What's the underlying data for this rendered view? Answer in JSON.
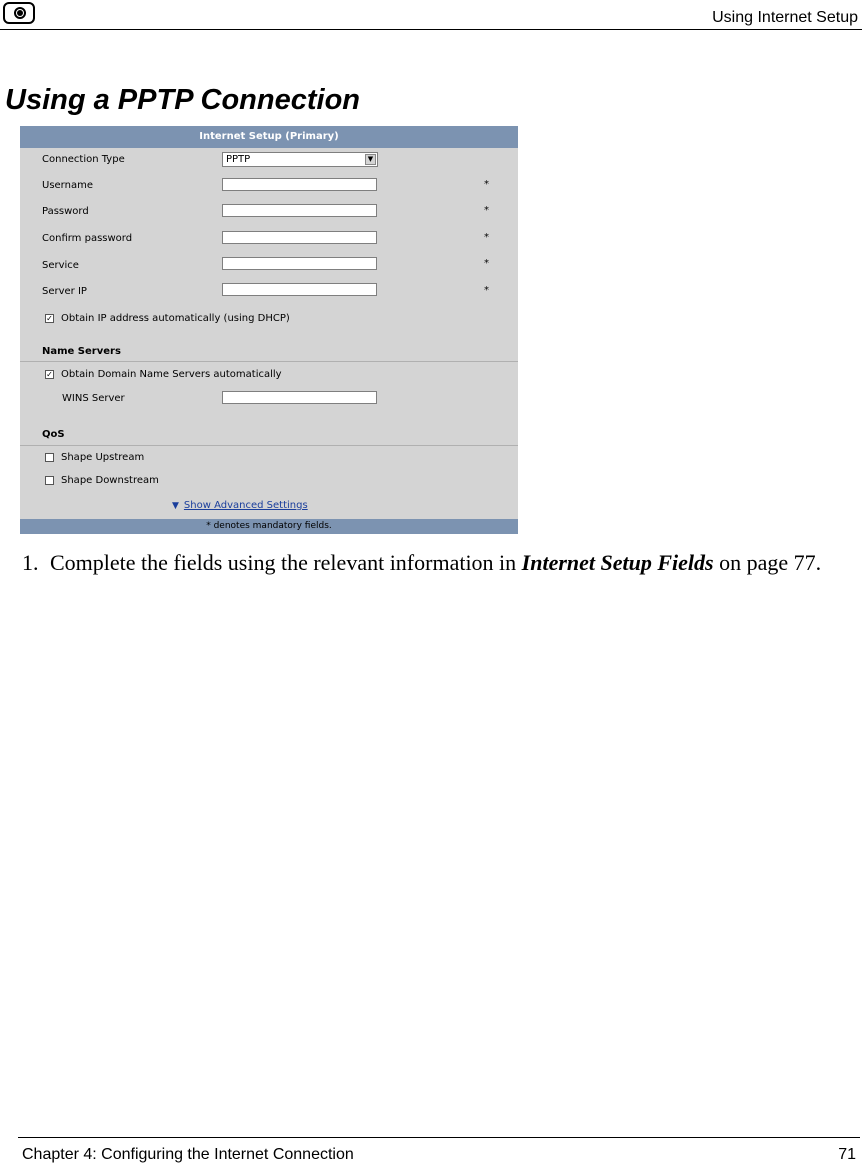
{
  "header": {
    "running_title": "Using Internet Setup"
  },
  "heading": "Using a PPTP Connection",
  "screenshot": {
    "title": "Internet Setup (Primary)",
    "connection_type_label": "Connection Type",
    "connection_type_value": "PPTP",
    "username_label": "Username",
    "password_label": "Password",
    "confirm_password_label": "Confirm password",
    "service_label": "Service",
    "server_ip_label": "Server IP",
    "required_marker": "*",
    "obtain_ip_label": "Obtain IP address automatically (using DHCP)",
    "obtain_ip_checked": "✓",
    "name_servers_section": "Name Servers",
    "obtain_dns_label": "Obtain Domain Name Servers automatically",
    "obtain_dns_checked": "✓",
    "wins_server_label": "WINS Server",
    "qos_section": "QoS",
    "shape_upstream_label": "Shape Upstream",
    "shape_downstream_label": "Shape Downstream",
    "advanced_triangle": "▼",
    "advanced_link": "Show Advanced Settings",
    "footnote": "* denotes mandatory fields."
  },
  "step": {
    "number": "1.",
    "text_before": "Complete the fields using the relevant information in ",
    "reference": "Internet Setup Fields",
    "text_after": " on page 77."
  },
  "footer": {
    "chapter": "Chapter 4: Configuring the Internet Connection",
    "page_number": "71"
  }
}
